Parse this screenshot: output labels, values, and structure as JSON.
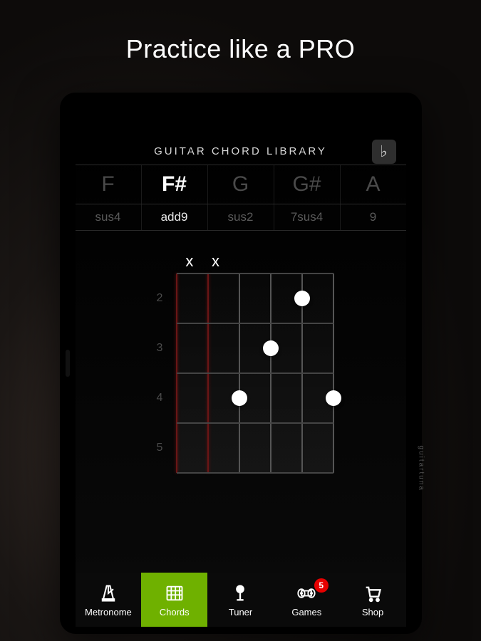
{
  "headline": "Practice like a PRO",
  "brand": "guitartuna",
  "header": {
    "title": "GUITAR CHORD LIBRARY",
    "flat_symbol": "♭"
  },
  "notes": [
    {
      "label": "F",
      "selected": false
    },
    {
      "label": "F#",
      "selected": true
    },
    {
      "label": "G",
      "selected": false
    },
    {
      "label": "G#",
      "selected": false
    },
    {
      "label": "A",
      "selected": false
    }
  ],
  "qualities": [
    {
      "label": "sus4",
      "selected": false
    },
    {
      "label": "add9",
      "selected": true
    },
    {
      "label": "sus2",
      "selected": false
    },
    {
      "label": "7sus4",
      "selected": false
    },
    {
      "label": "9",
      "selected": false
    }
  ],
  "chord": {
    "strings_muted": [
      true,
      true,
      false,
      false,
      false,
      false
    ],
    "mute_symbol": "x",
    "fret_numbers": [
      "2",
      "3",
      "4",
      "5"
    ],
    "dots": [
      {
        "string": 4,
        "fret": 1
      },
      {
        "string": 3,
        "fret": 2
      },
      {
        "string": 2,
        "fret": 3
      },
      {
        "string": 5,
        "fret": 3
      }
    ]
  },
  "tabs": [
    {
      "id": "metronome",
      "label": "Metronome",
      "active": false,
      "badge": null
    },
    {
      "id": "chords",
      "label": "Chords",
      "active": true,
      "badge": null
    },
    {
      "id": "tuner",
      "label": "Tuner",
      "active": false,
      "badge": null
    },
    {
      "id": "games",
      "label": "Games",
      "active": false,
      "badge": "5"
    },
    {
      "id": "shop",
      "label": "Shop",
      "active": false,
      "badge": null
    }
  ],
  "colors": {
    "accent": "#6fb100",
    "badge": "#e60000"
  }
}
